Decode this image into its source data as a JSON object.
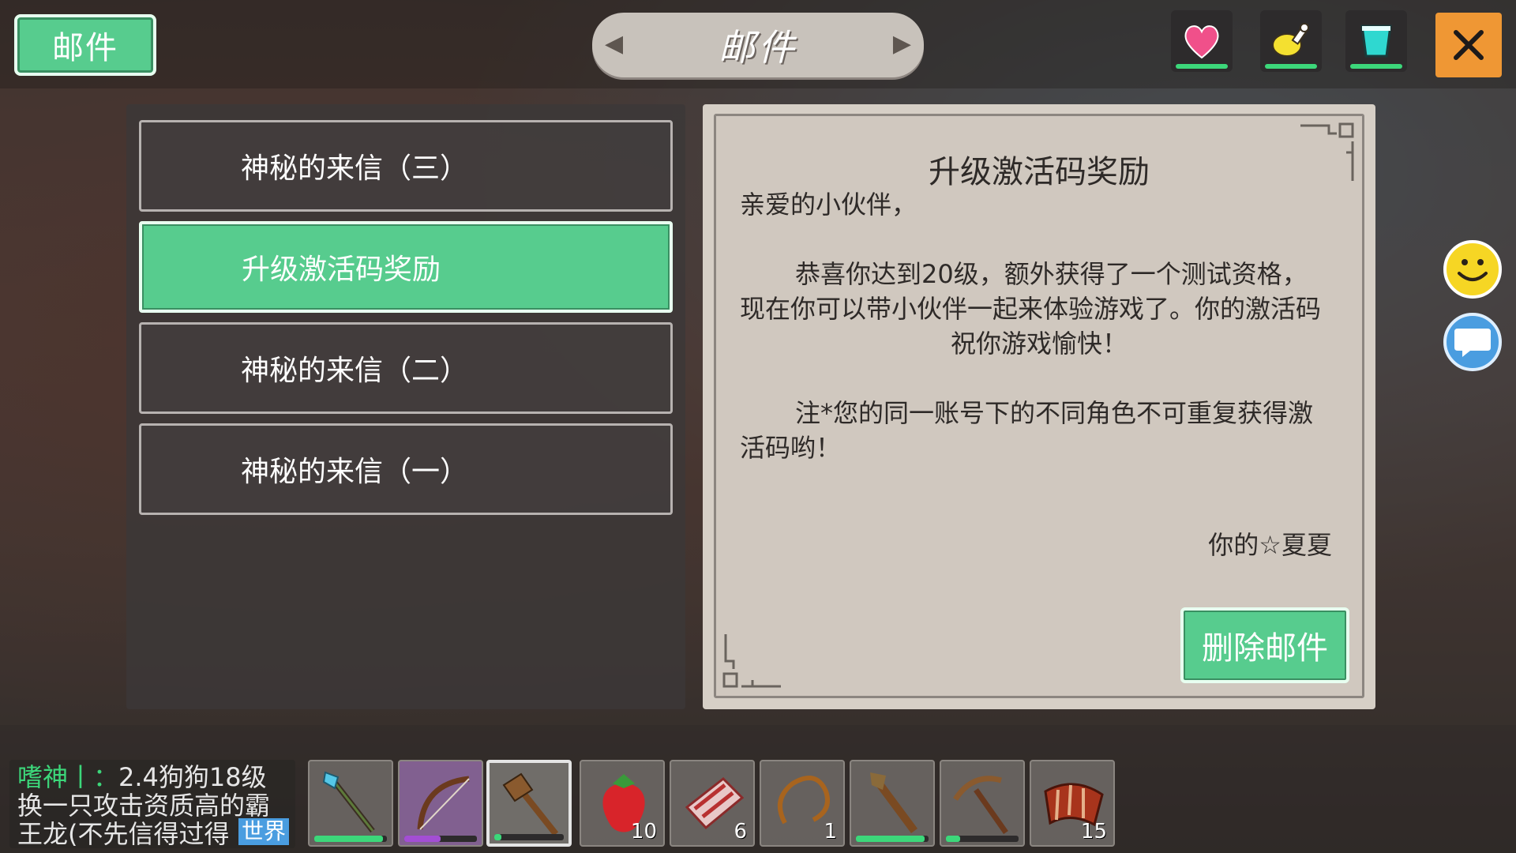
{
  "header": {
    "tab_label": "邮件",
    "title": "邮件",
    "close_glyph": "✕"
  },
  "status_icons": [
    "heart-icon",
    "drumstick-icon",
    "cup-icon"
  ],
  "mail_list": {
    "items": [
      {
        "label": "神秘的来信（三）",
        "active": false
      },
      {
        "label": "升级激活码奖励",
        "active": true
      },
      {
        "label": "神秘的来信（二）",
        "active": false
      },
      {
        "label": "神秘的来信（一）",
        "active": false
      }
    ]
  },
  "letter": {
    "heading": "升级激活码奖励",
    "greeting": "亲爱的小伙伴，",
    "paragraph1_line1": "恭喜你达到20级，额外获得了一个测试资格，",
    "paragraph1_line2": "现在你可以带小伙伴一起来体验游戏了。你的激活码",
    "paragraph1_line3": "祝你游戏愉快！",
    "paragraph2_line1": "注*您的同一账号下的不同角色不可重复获得激",
    "paragraph2_line2": "活码哟！",
    "signature": "你的☆夏夏",
    "delete_label": "删除邮件"
  },
  "chat": {
    "speaker": "嗜神丨：",
    "line1_rest": "2.4狗狗18级",
    "line2": "换一只攻击资质高的霸",
    "line3": "王龙(不先信得过得",
    "channel": "世界"
  },
  "hotbar": [
    {
      "item": "magic-staff",
      "count": "",
      "durability": 0.95
    },
    {
      "item": "bow",
      "count": "",
      "durability": 0.5,
      "bar_color": "#a34ed4"
    },
    {
      "item": "wooden-axe",
      "count": "",
      "durability": 0.1,
      "selected": true
    },
    {
      "item": "strawberry",
      "count": "10"
    },
    {
      "item": "raw-meat",
      "count": "6"
    },
    {
      "item": "rope",
      "count": "1"
    },
    {
      "item": "torch",
      "count": "",
      "durability": 0.95
    },
    {
      "item": "pickaxe",
      "count": "",
      "durability": 0.2
    },
    {
      "item": "ribs",
      "count": "15"
    }
  ],
  "colors": {
    "accent_green": "#57cc8e",
    "close_orange": "#ef9734",
    "panel_paper": "#d6cfc6"
  }
}
